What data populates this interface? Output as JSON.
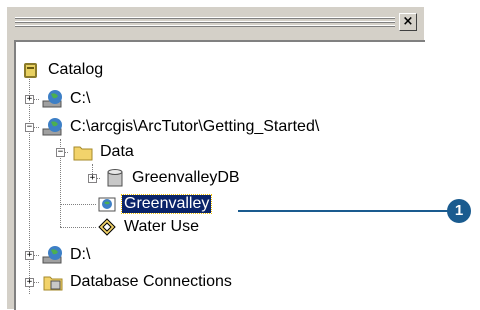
{
  "window": {
    "close_glyph": "×"
  },
  "tree": {
    "items": [
      {
        "label": "Catalog",
        "icon": "catalog-icon"
      },
      {
        "label": "C:\\",
        "icon": "drive-globe-icon",
        "expander": "+"
      },
      {
        "label": "C:\\arcgis\\ArcTutor\\Getting_Started\\",
        "icon": "drive-globe-icon",
        "expander": "−"
      },
      {
        "label": "Data",
        "icon": "folder-icon",
        "expander": "−"
      },
      {
        "label": "GreenvalleyDB",
        "icon": "database-icon",
        "expander": "+"
      },
      {
        "label": "Greenvalley",
        "icon": "map-document-icon",
        "selected": true
      },
      {
        "label": "Water Use",
        "icon": "layer-diamond-icon"
      },
      {
        "label": "D:\\",
        "icon": "drive-globe-icon",
        "expander": "+"
      },
      {
        "label": "Database Connections",
        "icon": "database-connection-icon",
        "expander": "+"
      }
    ]
  },
  "callout": {
    "number": "1"
  },
  "colors": {
    "selection": "#0a246a",
    "callout": "#1a5b8f",
    "panel": "#d4d0c8"
  }
}
